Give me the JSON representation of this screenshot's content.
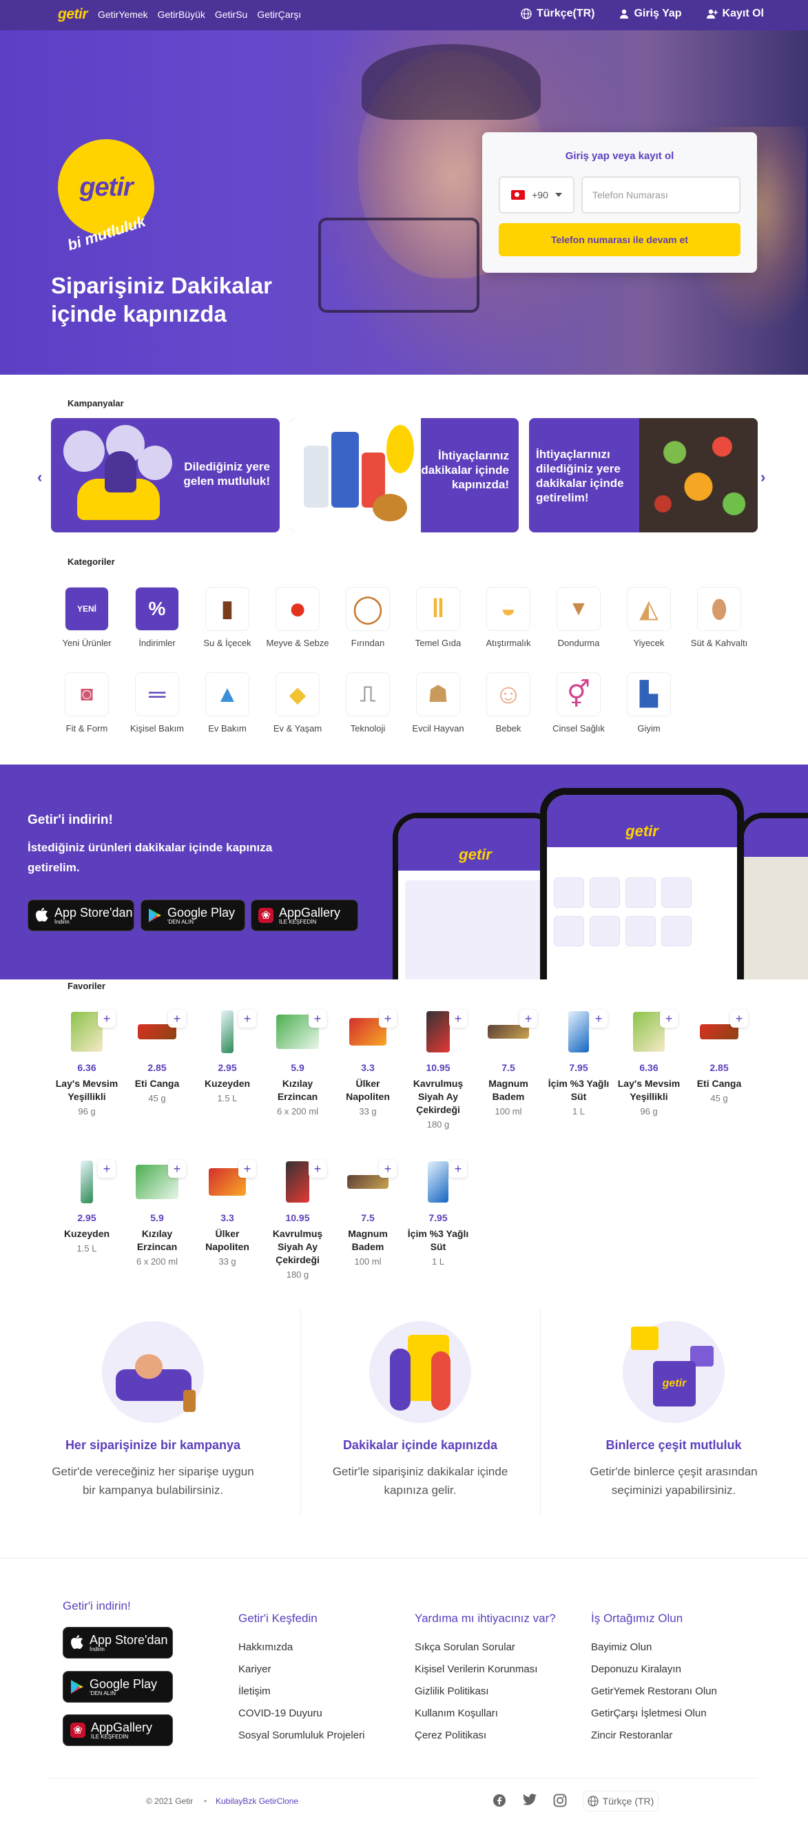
{
  "nav": {
    "logo": "getir",
    "links": [
      "GetirYemek",
      "GetirBüyük",
      "GetirSu",
      "GetirÇarşı"
    ],
    "language": "Türkçe(TR)",
    "login": "Giriş Yap",
    "signup": "Kayıt Ol"
  },
  "hero": {
    "logo_text": "getir",
    "tagline": "bi mutluluk",
    "title": "Siparişiniz Dakikalar içinde kapınızda",
    "login_card": {
      "title": "Giriş yap veya kayıt ol",
      "country_code": "+90",
      "phone_placeholder": "Telefon Numarası",
      "continue_button": "Telefon numarası ile devam et"
    }
  },
  "campaigns": {
    "title": "Kampanyalar",
    "items": [
      "Dilediğiniz yere gelen mutluluk!",
      "İhtiyaçlarınız dakikalar içinde kapınızda!",
      "İhtiyaçlarınızı dilediğiniz yere dakikalar içinde getirelim!"
    ]
  },
  "categories": {
    "title": "Kategoriler",
    "items": [
      {
        "label": "Yeni Ürünler",
        "icon": "new-tag-icon"
      },
      {
        "label": "İndirimler",
        "icon": "percent-bag-icon"
      },
      {
        "label": "Su & İçecek",
        "icon": "drink-icon"
      },
      {
        "label": "Meyve & Sebze",
        "icon": "tomato-icon"
      },
      {
        "label": "Fırından",
        "icon": "bagel-icon"
      },
      {
        "label": "Temel Gıda",
        "icon": "pasta-icon"
      },
      {
        "label": "Atıştırmalık",
        "icon": "snack-icon"
      },
      {
        "label": "Dondurma",
        "icon": "ice-cream-icon"
      },
      {
        "label": "Yiyecek",
        "icon": "sandwich-icon"
      },
      {
        "label": "Süt & Kahvaltı",
        "icon": "egg-icon"
      },
      {
        "label": "Fit & Form",
        "icon": "yogurt-icon"
      },
      {
        "label": "Kişisel Bakım",
        "icon": "toothbrush-icon"
      },
      {
        "label": "Ev Bakım",
        "icon": "detergent-icon"
      },
      {
        "label": "Ev & Yaşam",
        "icon": "lamp-icon"
      },
      {
        "label": "Teknoloji",
        "icon": "cable-icon"
      },
      {
        "label": "Evcil Hayvan",
        "icon": "cat-icon"
      },
      {
        "label": "Bebek",
        "icon": "baby-icon"
      },
      {
        "label": "Cinsel Sağlık",
        "icon": "gender-icon"
      },
      {
        "label": "Giyim",
        "icon": "sock-icon"
      }
    ]
  },
  "download": {
    "title": "Getir'i indirin!",
    "description": "İstediğiniz ürünleri dakikalar içinde kapınıza getirelim.",
    "stores": [
      {
        "name": "App Store'dan",
        "sub": "İndirin"
      },
      {
        "name": "Google Play",
        "sub": "'DEN ALIN"
      },
      {
        "name": "AppGallery",
        "sub": "İLE KEŞFEDİN"
      }
    ]
  },
  "favorites": {
    "title": "Favoriler",
    "items": [
      {
        "price": "6.36",
        "name": "Lay's Mevsim Yeşillikli",
        "attr": "96 g"
      },
      {
        "price": "2.85",
        "name": "Eti Canga",
        "attr": "45 g"
      },
      {
        "price": "2.95",
        "name": "Kuzeyden",
        "attr": "1.5 L"
      },
      {
        "price": "5.9",
        "name": "Kızılay Erzincan",
        "attr": "6 x 200 ml"
      },
      {
        "price": "3.3",
        "name": "Ülker Napoliten",
        "attr": "33 g"
      },
      {
        "price": "10.95",
        "name": "Kavrulmuş Siyah Ay Çekirdeği",
        "attr": "180 g"
      },
      {
        "price": "7.5",
        "name": "Magnum Badem",
        "attr": "100 ml"
      },
      {
        "price": "7.95",
        "name": "İçim %3 Yağlı Süt",
        "attr": "1 L"
      },
      {
        "price": "6.36",
        "name": "Lay's Mevsim Yeşillikli",
        "attr": "96 g"
      },
      {
        "price": "2.85",
        "name": "Eti Canga",
        "attr": "45 g"
      },
      {
        "price": "2.95",
        "name": "Kuzeyden",
        "attr": "1.5 L"
      },
      {
        "price": "5.9",
        "name": "Kızılay Erzincan",
        "attr": "6 x 200 ml"
      },
      {
        "price": "3.3",
        "name": "Ülker Napoliten",
        "attr": "33 g"
      },
      {
        "price": "10.95",
        "name": "Kavrulmuş Siyah Ay Çekirdeği",
        "attr": "180 g"
      },
      {
        "price": "7.5",
        "name": "Magnum Badem",
        "attr": "100 ml"
      },
      {
        "price": "7.95",
        "name": "İçim %3 Yağlı Süt",
        "attr": "1 L"
      }
    ]
  },
  "features": [
    {
      "title": "Her siparişinize bir kampanya",
      "desc": "Getir'de vereceğiniz her siparişe uygun bir kampanya bulabilirsiniz."
    },
    {
      "title": "Dakikalar içinde kapınızda",
      "desc": "Getir'le siparişiniz dakikalar içinde kapınıza gelir."
    },
    {
      "title": "Binlerce çeşit mutluluk",
      "desc": "Getir'de binlerce çeşit arasından seçiminizi yapabilirsiniz."
    }
  ],
  "footer": {
    "download_title": "Getir'i indirin!",
    "columns": [
      {
        "title": "Getir'i Keşfedin",
        "links": [
          "Hakkımızda",
          "Kariyer",
          "İletişim",
          "COVID-19 Duyuru",
          "Sosyal Sorumluluk Projeleri"
        ]
      },
      {
        "title": "Yardıma mı ihtiyacınız var?",
        "links": [
          "Sıkça Sorulan Sorular",
          "Kişisel Verilerin Korunması",
          "Gizlilik Politikası",
          "Kullanım Koşulları",
          "Çerez Politikası"
        ]
      },
      {
        "title": "İş Ortağımız Olun",
        "links": [
          "Bayimiz Olun",
          "Deponuzu Kiralayın",
          "GetirYemek Restoranı Olun",
          "GetirÇarşı İşletmesi Olun",
          "Zincir Restoranlar"
        ]
      }
    ],
    "copyright": "© 2021 Getir",
    "credit": "KubilayBzk GetirClone",
    "language": "Türkçe (TR)"
  },
  "colors": {
    "brand_purple": "#5d3ebc",
    "brand_yellow": "#ffd300",
    "nav_purple": "#4c3398"
  }
}
